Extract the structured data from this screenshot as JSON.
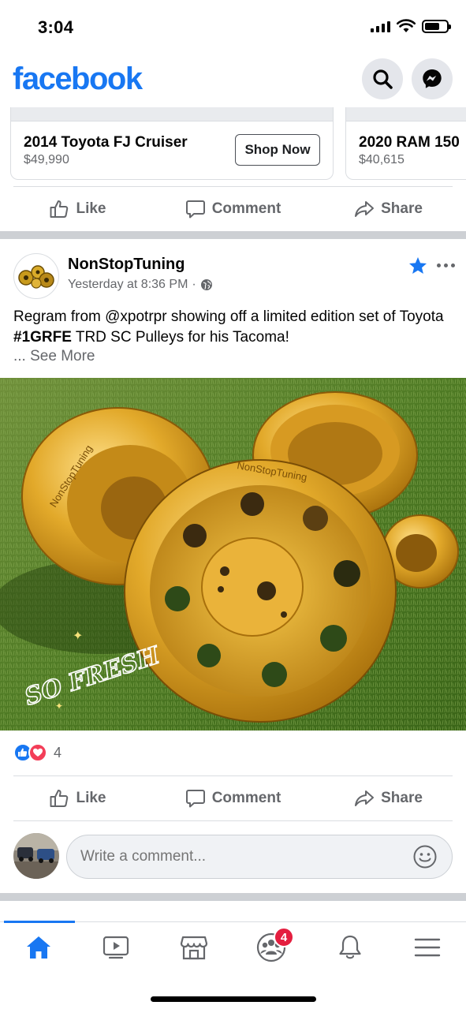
{
  "status_bar": {
    "time": "3:04"
  },
  "header": {
    "logo": "facebook",
    "search_icon": "search-icon",
    "messenger_icon": "messenger-icon"
  },
  "carousel": {
    "cards": [
      {
        "title": "2014 Toyota FJ Cruiser",
        "price": "$49,990",
        "button": "Shop Now"
      },
      {
        "title": "2020 RAM 150",
        "price": "$40,615"
      }
    ]
  },
  "actions": {
    "like": "Like",
    "comment": "Comment",
    "share": "Share"
  },
  "post": {
    "author": "NonStopTuning",
    "time": "Yesterday at 8:36 PM",
    "meta_separator": "·",
    "text_before": "Regram from @xpotrpr showing off a limited edition set of Toyota ",
    "hashtag": "#1GRFE",
    "text_after": " TRD SC Pulleys for his Tacoma!",
    "see_more": "... See More",
    "image_caption_art": "SO FRESH",
    "engraving": "NonStopTuning",
    "reactions_count": "4"
  },
  "comment_box": {
    "placeholder": "Write a comment..."
  },
  "bottom_nav": {
    "items": [
      "home-icon",
      "watch-icon",
      "marketplace-icon",
      "groups-icon",
      "notifications-icon",
      "menu-icon"
    ],
    "groups_badge": "4"
  },
  "colors": {
    "brand": "#1877f2",
    "badge": "#e41e3f",
    "love": "#f33e58",
    "separator": "#cdd0d4"
  }
}
